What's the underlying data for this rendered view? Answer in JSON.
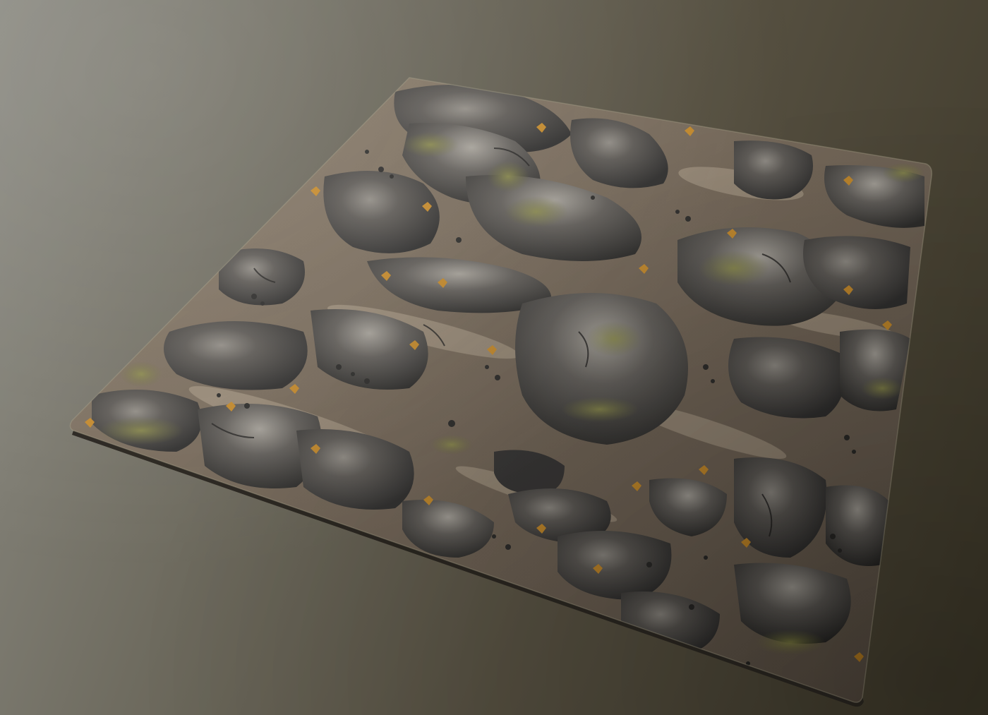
{
  "viewport": {
    "background_colors": [
      "#8d8c84",
      "#6f6c60",
      "#565041",
      "#3b3627"
    ]
  },
  "material": {
    "colors": {
      "dirt": "#7a6b58",
      "dirt_light": "#a08f76",
      "rock_dark": "#2e2c2a",
      "rock_mid": "#4a4744",
      "rock_highlight": "#9a958c",
      "moss": "#7b7a3a",
      "leaf": "#c8861c"
    }
  }
}
